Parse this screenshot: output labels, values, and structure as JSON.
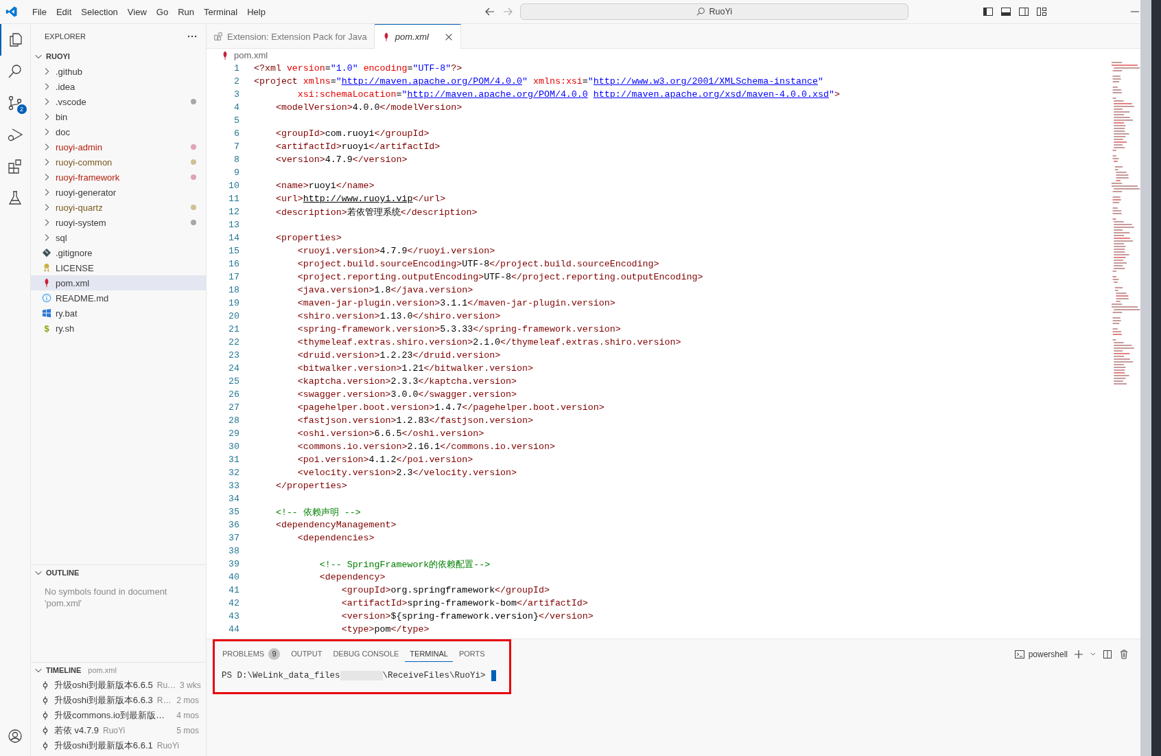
{
  "menu": [
    "File",
    "Edit",
    "Selection",
    "View",
    "Go",
    "Run",
    "Terminal",
    "Help"
  ],
  "command_center": {
    "text": "RuoYi"
  },
  "activity_bar": [
    {
      "kind": "explorer",
      "selected": true
    },
    {
      "kind": "search",
      "selected": false
    },
    {
      "kind": "scm",
      "selected": false,
      "badge": "2"
    },
    {
      "kind": "debug",
      "selected": false
    },
    {
      "kind": "extensions",
      "selected": false
    },
    {
      "kind": "testing",
      "selected": false
    }
  ],
  "sidebar": {
    "title": "EXPLORER",
    "folder": "RUOYI",
    "items": [
      {
        "label": ".github",
        "kind": "folder",
        "selected": false
      },
      {
        "label": ".idea",
        "kind": "folder",
        "selected": false
      },
      {
        "label": ".vscode",
        "kind": "folder",
        "selected": false,
        "color": "#a8a8a8"
      },
      {
        "label": "bin",
        "kind": "folder",
        "selected": false
      },
      {
        "label": "doc",
        "kind": "folder",
        "selected": false
      },
      {
        "label": "ruoyi-admin",
        "kind": "folder",
        "selected": false,
        "color": "#e0a3b5"
      },
      {
        "label": "ruoyi-common",
        "kind": "folder",
        "selected": false,
        "color": "#d3bf95"
      },
      {
        "label": "ruoyi-framework",
        "kind": "folder",
        "selected": false,
        "color": "#e0a3b5"
      },
      {
        "label": "ruoyi-generator",
        "kind": "folder",
        "selected": false
      },
      {
        "label": "ruoyi-quartz",
        "kind": "folder",
        "selected": false,
        "color": "#d3bf95"
      },
      {
        "label": "ruoyi-system",
        "kind": "folder",
        "selected": false,
        "color": "#a8a8a8"
      },
      {
        "label": "sql",
        "kind": "folder",
        "selected": false
      },
      {
        "label": ".gitignore",
        "kind": "git",
        "selected": false
      },
      {
        "label": "LICENSE",
        "kind": "license",
        "selected": false
      },
      {
        "label": "pom.xml",
        "kind": "maven",
        "selected": true
      },
      {
        "label": "README.md",
        "kind": "info",
        "selected": false
      },
      {
        "label": "ry.bat",
        "kind": "windows",
        "selected": false
      },
      {
        "label": "ry.sh",
        "kind": "shell",
        "glyph": "$",
        "selected": false
      }
    ],
    "outline": {
      "title": "OUTLINE",
      "message": "No symbols found in document 'pom.xml'"
    },
    "timeline": {
      "title": "TIMELINE",
      "file": "pom.xml",
      "entries": [
        {
          "title": "升级oshi到最新版本6.6.5",
          "author": "Ru…",
          "time": "3 wks"
        },
        {
          "title": "升级oshi到最新版本6.6.3",
          "author": "R…",
          "time": "2 mos"
        },
        {
          "title": "升级commons.io到最新版…",
          "time": "4 mos"
        },
        {
          "title": "若依 v4.7.9",
          "author": "RuoYi",
          "time": "5 mos"
        },
        {
          "title": "升级oshi到最新版本6.6.1",
          "author": "RuoYi"
        }
      ]
    }
  },
  "tabs": [
    {
      "label": "Extension: Extension Pack for Java",
      "kind": "extension",
      "selected": false
    },
    {
      "label": "pom.xml",
      "kind": "maven",
      "selected": true,
      "preview": true
    }
  ],
  "breadcrumb": "pom.xml",
  "code": [
    {
      "number": "1",
      "code": "<?xml version=\"1.0\" encoding=\"UTF-8\"?>"
    },
    {
      "number": "2",
      "code": "<project xmlns=\"http://maven.apache.org/POM/4.0.0\" xmlns:xsi=\"http://www.w3.org/2001/XMLSchema-instance\""
    },
    {
      "number": "3",
      "code": "        xsi:schemaLocation=\"http://maven.apache.org/POM/4.0.0 http://maven.apache.org/xsd/maven-4.0.0.xsd\">"
    },
    {
      "number": "4",
      "code": "    <modelVersion>4.0.0</modelVersion>"
    },
    {
      "number": "5"
    },
    {
      "number": "6",
      "code": "    <groupId>com.ruoyi</groupId>"
    },
    {
      "number": "7",
      "code": "    <artifactId>ruoyi</artifactId>"
    },
    {
      "number": "8",
      "code": "    <version>4.7.9</version>"
    },
    {
      "number": "9"
    },
    {
      "number": "10",
      "code": "    <name>ruoyi</name>"
    },
    {
      "number": "11",
      "code": "    <url>http://www.ruoyi.vip</url>"
    },
    {
      "number": "12",
      "code": "    <description>若依管理系统</description>"
    },
    {
      "number": "13"
    },
    {
      "number": "14",
      "code": "    <properties>"
    },
    {
      "number": "15",
      "code": "        <ruoyi.version>4.7.9</ruoyi.version>"
    },
    {
      "number": "16",
      "code": "        <project.build.sourceEncoding>UTF-8</project.build.sourceEncoding>"
    },
    {
      "number": "17",
      "code": "        <project.reporting.outputEncoding>UTF-8</project.reporting.outputEncoding>"
    },
    {
      "number": "18",
      "code": "        <java.version>1.8</java.version>"
    },
    {
      "number": "19",
      "code": "        <maven-jar-plugin.version>3.1.1</maven-jar-plugin.version>"
    },
    {
      "number": "20",
      "code": "        <shiro.version>1.13.0</shiro.version>"
    },
    {
      "number": "21",
      "code": "        <spring-framework.version>5.3.33</spring-framework.version>"
    },
    {
      "number": "22",
      "code": "        <thymeleaf.extras.shiro.version>2.1.0</thymeleaf.extras.shiro.version>"
    },
    {
      "number": "23",
      "code": "        <druid.version>1.2.23</druid.version>"
    },
    {
      "number": "24",
      "code": "        <bitwalker.version>1.21</bitwalker.version>"
    },
    {
      "number": "25",
      "code": "        <kaptcha.version>2.3.3</kaptcha.version>"
    },
    {
      "number": "26",
      "code": "        <swagger.version>3.0.0</swagger.version>"
    },
    {
      "number": "27",
      "code": "        <pagehelper.boot.version>1.4.7</pagehelper.boot.version>"
    },
    {
      "number": "28",
      "code": "        <fastjson.version>1.2.83</fastjson.version>"
    },
    {
      "number": "29",
      "code": "        <oshi.version>6.6.5</oshi.version>"
    },
    {
      "number": "30",
      "code": "        <commons.io.version>2.16.1</commons.io.version>"
    },
    {
      "number": "31",
      "code": "        <poi.version>4.1.2</poi.version>"
    },
    {
      "number": "32",
      "code": "        <velocity.version>2.3</velocity.version>"
    },
    {
      "number": "33",
      "code": "    </properties>"
    },
    {
      "number": "34"
    },
    {
      "number": "35",
      "code": "    <!-- 依赖声明 -->"
    },
    {
      "number": "36",
      "code": "    <dependencyManagement>"
    },
    {
      "number": "37",
      "code": "        <dependencies>"
    },
    {
      "number": "38"
    },
    {
      "number": "39",
      "code": "            <!-- SpringFramework的依赖配置-->"
    },
    {
      "number": "40",
      "code": "            <dependency>"
    },
    {
      "number": "41",
      "code": "                <groupId>org.springframework</groupId>"
    },
    {
      "number": "42",
      "code": "                <artifactId>spring-framework-bom</artifactId>"
    },
    {
      "number": "43",
      "code": "                <version>${spring-framework.version}</version>"
    },
    {
      "number": "44",
      "code": "                <type>pom</type>"
    }
  ],
  "panel": {
    "tabs": [
      {
        "label": "PROBLEMS",
        "badge": "9",
        "selected": false
      },
      {
        "label": "OUTPUT",
        "selected": false
      },
      {
        "label": "DEBUG CONSOLE",
        "selected": false
      },
      {
        "label": "TERMINAL",
        "selected": true
      },
      {
        "label": "PORTS",
        "selected": false
      }
    ],
    "shell": "powershell",
    "terminal": {
      "prompt_start": "PS D:\\WeLink_data_files",
      "prompt_end": "\\ReceiveFiles\\RuoYi>"
    }
  }
}
